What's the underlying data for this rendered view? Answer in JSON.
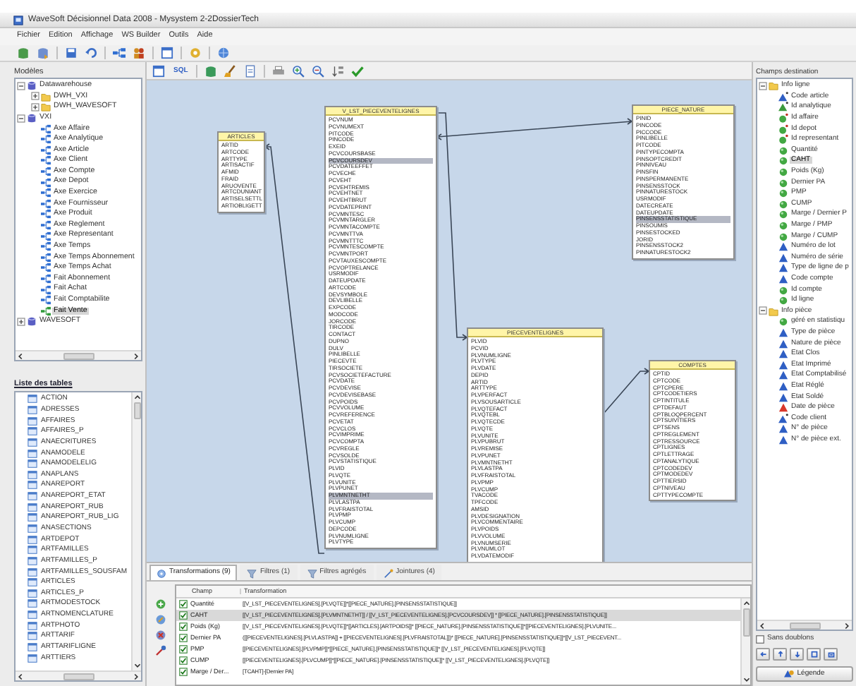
{
  "window": {
    "title": "WaveSoft Décisionnel Data 2008 - Mysystem 2-2DossierTech"
  },
  "menu": [
    "Fichier",
    "Edition",
    "Affichage",
    "WS Builder",
    "Outils",
    "Aide"
  ],
  "diagram_toolbar": {
    "sql_label": "SQL"
  },
  "models": {
    "label": "Modèles",
    "tree": [
      {
        "label": "Datawarehouse",
        "kind": "database",
        "expanded": true,
        "selected": false,
        "children": [
          {
            "label": "DWH_VXI",
            "kind": "folder",
            "expanded": false,
            "selected": false
          },
          {
            "label": "DWH_WAVESOFT",
            "kind": "folder",
            "expanded": false,
            "selected": false
          }
        ]
      },
      {
        "label": "VXI",
        "kind": "database",
        "expanded": true,
        "selected": false,
        "children": [
          {
            "label": "Axe Affaire",
            "kind": "axis",
            "selected": false
          },
          {
            "label": "Axe Analytique",
            "kind": "axis",
            "selected": false
          },
          {
            "label": "Axe Article",
            "kind": "axis",
            "selected": false
          },
          {
            "label": "Axe Client",
            "kind": "axis",
            "selected": false
          },
          {
            "label": "Axe Compte",
            "kind": "axis",
            "selected": false
          },
          {
            "label": "Axe Depot",
            "kind": "axis",
            "selected": false
          },
          {
            "label": "Axe Exercice",
            "kind": "axis",
            "selected": false
          },
          {
            "label": "Axe Fournisseur",
            "kind": "axis",
            "selected": false
          },
          {
            "label": "Axe Produit",
            "kind": "axis",
            "selected": false
          },
          {
            "label": "Axe Reglement",
            "kind": "axis",
            "selected": false
          },
          {
            "label": "Axe Representant",
            "kind": "axis",
            "selected": false
          },
          {
            "label": "Axe Temps",
            "kind": "axis",
            "selected": false
          },
          {
            "label": "Axe Temps Abonnement",
            "kind": "axis",
            "selected": false
          },
          {
            "label": "Axe Temps Achat",
            "kind": "axis",
            "selected": false
          },
          {
            "label": "Fait Abonnement",
            "kind": "axis",
            "selected": false
          },
          {
            "label": "Fait Achat",
            "kind": "axis",
            "selected": false
          },
          {
            "label": "Fait Comptabilite",
            "kind": "axis",
            "selected": false
          },
          {
            "label": "Fait Vente",
            "kind": "axis",
            "selected": true
          }
        ]
      },
      {
        "label": "WAVESOFT",
        "kind": "database",
        "expanded": false,
        "selected": false
      }
    ]
  },
  "tables_list": {
    "label": "Liste des tables",
    "items": [
      "ACTION",
      "ADRESSES",
      "AFFAIRES",
      "AFFAIRES_P",
      "ANAECRITURES",
      "ANAMODELE",
      "ANAMODELELIG",
      "ANAPLANS",
      "ANAREPORT",
      "ANAREPORT_ETAT",
      "ANAREPORT_RUB",
      "ANAREPORT_RUB_LIG",
      "ANASECTIONS",
      "ARTDEPOT",
      "ARTFAMILLES",
      "ARTFAMILLES_P",
      "ARTFAMILLES_SOUSFAM",
      "ARTICLES",
      "ARTICLES_P",
      "ARTMODESTOCK",
      "ARTNOMENCLATURE",
      "ARTPHOTO",
      "ARTTARIF",
      "ARTTARIFLIGNE",
      "ARTTIERS"
    ]
  },
  "diagram": {
    "tables": [
      {
        "name": "ARTICLES",
        "fields": [
          {
            "name": "ARTID",
            "selected": false
          },
          {
            "name": "ARTCODE",
            "selected": false
          },
          {
            "name": "ARTTYPE",
            "selected": false
          },
          {
            "name": "ARTISACTIF",
            "selected": false
          },
          {
            "name": "AFMID",
            "selected": false
          },
          {
            "name": "FRAID",
            "selected": false
          },
          {
            "name": "ARUOVENTE",
            "selected": false
          },
          {
            "name": "ARTCDUNIANT",
            "selected": false
          },
          {
            "name": "ARTISELSETTL",
            "selected": false
          },
          {
            "name": "ARTIOBLIGETT",
            "selected": false
          }
        ]
      },
      {
        "name": "V_LST_PIECEVENTELIGNES",
        "fields": [
          {
            "name": "PCVNUM",
            "selected": false
          },
          {
            "name": "PCVNUMEXT",
            "selected": false
          },
          {
            "name": "PITCODE",
            "selected": false
          },
          {
            "name": "PINCODE",
            "selected": false
          },
          {
            "name": "EXEID",
            "selected": false
          },
          {
            "name": "PCVCOURSBASE",
            "selected": false
          },
          {
            "name": "PCVCOURSDEV",
            "selected": true
          },
          {
            "name": "PCVDATEEFFET",
            "selected": false
          },
          {
            "name": "PCVECHE",
            "selected": false
          },
          {
            "name": "PCVEHT",
            "selected": false
          },
          {
            "name": "PCVEHTREMIS",
            "selected": false
          },
          {
            "name": "PCVEHTNET",
            "selected": false
          },
          {
            "name": "PCVEHTBRUT",
            "selected": false
          },
          {
            "name": "PCVDATEPRINT",
            "selected": false
          },
          {
            "name": "PCVMNTESC",
            "selected": false
          },
          {
            "name": "PCVMNTARGLER",
            "selected": false
          },
          {
            "name": "PCVMNTACOMPTE",
            "selected": false
          },
          {
            "name": "PCVMNTTVA",
            "selected": false
          },
          {
            "name": "PCVMNTTTC",
            "selected": false
          },
          {
            "name": "PCVMNTESCOMPTE",
            "selected": false
          },
          {
            "name": "PCVMNTPORT",
            "selected": false
          },
          {
            "name": "PCVTAUXESCOMPTE",
            "selected": false
          },
          {
            "name": "PCVOPTRELANCE",
            "selected": false
          },
          {
            "name": "USRMODIF",
            "selected": false
          },
          {
            "name": "DATEUPDATE",
            "selected": false
          },
          {
            "name": "ARTCODE",
            "selected": false
          },
          {
            "name": "DEVSYMBOLE",
            "selected": false
          },
          {
            "name": "DEVLIBELLE",
            "selected": false
          },
          {
            "name": "EXPCODE",
            "selected": false
          },
          {
            "name": "MODCODE",
            "selected": false
          },
          {
            "name": "JORCODE",
            "selected": false
          },
          {
            "name": "TIRCODE",
            "selected": false
          },
          {
            "name": "CONTACT",
            "selected": false
          },
          {
            "name": "DUPNO",
            "selected": false
          },
          {
            "name": "DULV",
            "selected": false
          },
          {
            "name": "PINLIBELLE",
            "selected": false
          },
          {
            "name": "PIECEVTE",
            "selected": false
          },
          {
            "name": "TIRSOCIETE",
            "selected": false
          },
          {
            "name": "PCVSOCIETEFACTURE",
            "selected": false
          },
          {
            "name": "PCVDATE",
            "selected": false
          },
          {
            "name": "PCVDEVISE",
            "selected": false
          },
          {
            "name": "PCVDEVISEBASE",
            "selected": false
          },
          {
            "name": "PCVPOIDS",
            "selected": false
          },
          {
            "name": "PCVVOLUME",
            "selected": false
          },
          {
            "name": "PCVREFERENCE",
            "selected": false
          },
          {
            "name": "PCVETAT",
            "selected": false
          },
          {
            "name": "PCVCLOS",
            "selected": false
          },
          {
            "name": "PCVIMPRIME",
            "selected": false
          },
          {
            "name": "PCVCOMPTA",
            "selected": false
          },
          {
            "name": "PCVREGLE",
            "selected": false
          },
          {
            "name": "PCVSOLDE",
            "selected": false
          },
          {
            "name": "PCVSTATISTIQUE",
            "selected": false
          },
          {
            "name": "PLVID",
            "selected": false
          },
          {
            "name": "PLVQTE",
            "selected": false
          },
          {
            "name": "PLVUNITE",
            "selected": false
          },
          {
            "name": "PLVPUNET",
            "selected": false
          },
          {
            "name": "PLVMNTNETHT",
            "selected": true
          },
          {
            "name": "PLVLASTPA",
            "selected": false
          },
          {
            "name": "PLVFRAISTOTAL",
            "selected": false
          },
          {
            "name": "PLVPMP",
            "selected": false
          },
          {
            "name": "PLVCUMP",
            "selected": false
          },
          {
            "name": "DEPCODE",
            "selected": false
          },
          {
            "name": "PLVNUMLIGNE",
            "selected": false
          },
          {
            "name": "PLVTYPE",
            "selected": false
          }
        ]
      },
      {
        "name": "PIECE_NATURE",
        "fields": [
          {
            "name": "PINID",
            "selected": false
          },
          {
            "name": "PINCODE",
            "selected": false
          },
          {
            "name": "PICCODE",
            "selected": false
          },
          {
            "name": "PINLIBELLE",
            "selected": false
          },
          {
            "name": "PITCODE",
            "selected": false
          },
          {
            "name": "PINTYPECOMPTA",
            "selected": false
          },
          {
            "name": "PINSOPTCREDIT",
            "selected": false
          },
          {
            "name": "PINNIVEAU",
            "selected": false
          },
          {
            "name": "PINSFIN",
            "selected": false
          },
          {
            "name": "PINSPERMANENTE",
            "selected": false
          },
          {
            "name": "PINSENSSTOCK",
            "selected": false
          },
          {
            "name": "PINNATURESTOCK",
            "selected": false
          },
          {
            "name": "USRMODIF",
            "selected": false
          },
          {
            "name": "DATECREATE",
            "selected": false
          },
          {
            "name": "DATEUPDATE",
            "selected": false
          },
          {
            "name": "PINSENSSTATISTIQUE",
            "selected": true
          },
          {
            "name": "PINSOUMIS",
            "selected": false
          },
          {
            "name": "PINSESTOCKED",
            "selected": false
          },
          {
            "name": "JORID",
            "selected": false
          },
          {
            "name": "PINSENSSTOCK2",
            "selected": false
          },
          {
            "name": "PINNATURESTOCK2",
            "selected": false
          }
        ]
      },
      {
        "name": "PIECEVENTELIGNES",
        "fields": [
          {
            "name": "PLVID",
            "selected": false
          },
          {
            "name": "PCVID",
            "selected": false
          },
          {
            "name": "PLVNUMLIGNE",
            "selected": false
          },
          {
            "name": "PLVTYPE",
            "selected": false
          },
          {
            "name": "PLVDATE",
            "selected": false
          },
          {
            "name": "DEPID",
            "selected": false
          },
          {
            "name": "ARTID",
            "selected": false
          },
          {
            "name": "ARTTYPE",
            "selected": false
          },
          {
            "name": "PLVPERFACT",
            "selected": false
          },
          {
            "name": "PLVSOUSARTICLE",
            "selected": false
          },
          {
            "name": "PLVQTEFACT",
            "selected": false
          },
          {
            "name": "PLVQTEBL",
            "selected": false
          },
          {
            "name": "PLVQTECDE",
            "selected": false
          },
          {
            "name": "PLVQTE",
            "selected": false
          },
          {
            "name": "PLVUNITE",
            "selected": false
          },
          {
            "name": "PLVPUBRUT",
            "selected": false
          },
          {
            "name": "PLVREMISE",
            "selected": false
          },
          {
            "name": "PLVPUNET",
            "selected": false
          },
          {
            "name": "PLVMNTNETHT",
            "selected": false
          },
          {
            "name": "PLVLASTPA",
            "selected": false
          },
          {
            "name": "PLVFRAISTOTAL",
            "selected": false
          },
          {
            "name": "PLVPMP",
            "selected": false
          },
          {
            "name": "PLVCUMP",
            "selected": false
          },
          {
            "name": "TVACODE",
            "selected": false
          },
          {
            "name": "TPFCODE",
            "selected": false
          },
          {
            "name": "AMSID",
            "selected": false
          },
          {
            "name": "PLVDESIGNATION",
            "selected": false
          },
          {
            "name": "PLVCOMMENTAIRE",
            "selected": false
          },
          {
            "name": "PLVPOIDS",
            "selected": false
          },
          {
            "name": "PLVVOLUME",
            "selected": false
          },
          {
            "name": "PLVNUMSERIE",
            "selected": false
          },
          {
            "name": "PLVNUMLOT",
            "selected": false
          },
          {
            "name": "PLVDATEMODIF",
            "selected": false
          }
        ]
      },
      {
        "name": "COMPTES",
        "fields": [
          {
            "name": "CPTID",
            "selected": false
          },
          {
            "name": "CPTCODE",
            "selected": false
          },
          {
            "name": "CPTCPERE",
            "selected": false
          },
          {
            "name": "CPTCODETIERS",
            "selected": false
          },
          {
            "name": "CPTINTITULE",
            "selected": false
          },
          {
            "name": "CPTDEFAUT",
            "selected": false
          },
          {
            "name": "CPTBLOQPERCENT",
            "selected": false
          },
          {
            "name": "CPTSUIVITIERS",
            "selected": false
          },
          {
            "name": "CPTSENS",
            "selected": false
          },
          {
            "name": "CPTREGLEMENT",
            "selected": false
          },
          {
            "name": "CPTRESSOURCE",
            "selected": false
          },
          {
            "name": "CPTLIGNES",
            "selected": false
          },
          {
            "name": "CPTLETTRAGE",
            "selected": false
          },
          {
            "name": "CPTANALYTIQUE",
            "selected": false
          },
          {
            "name": "CPTCODEDEV",
            "selected": false
          },
          {
            "name": "CPTMODEDEV",
            "selected": false
          },
          {
            "name": "CPTTIERSID",
            "selected": false
          },
          {
            "name": "CPTNIVEAU",
            "selected": false
          },
          {
            "name": "CPTTYPECOMPTE",
            "selected": false
          }
        ]
      }
    ]
  },
  "bottom_tabs": [
    {
      "label": "Transformations (9)",
      "kind": "transform",
      "selected": true
    },
    {
      "label": "Filtres (1)",
      "kind": "filter",
      "selected": false
    },
    {
      "label": "Filtres agrégés",
      "kind": "filter",
      "selected": false
    },
    {
      "label": "Jointures (4)",
      "kind": "join",
      "selected": false
    }
  ],
  "grid": {
    "columns": [
      "Champ",
      "Transformation"
    ],
    "rows": [
      {
        "checked": true,
        "selected": false,
        "champ": "Quantité",
        "transformation": "[[V_LST_PIECEVENTELIGNES].[PLVQTE]]*[[PIECE_NATURE].[PINSENSSTATISTIQUE]]"
      },
      {
        "checked": true,
        "selected": true,
        "champ": "CAHT",
        "transformation": "[[V_LST_PIECEVENTELIGNES].[PLVMNTNETHT]] / [[V_LST_PIECEVENTELIGNES].[PCVCOURSDEV]] * [[PIECE_NATURE].[PINSENSSTATISTIQUE]]"
      },
      {
        "checked": true,
        "selected": false,
        "champ": "Poids (Kg)",
        "transformation": "[[V_LST_PIECEVENTELIGNES].[PLVQTE]]*[[ARTICLES].[ARTPOIDS]]* [[PIECE_NATURE].[PINSENSSTATISTIQUE]]*[[PIECEVENTELIGNES].[PLVUNITE..."
      },
      {
        "checked": true,
        "selected": false,
        "champ": "Dernier PA",
        "transformation": "([[PIECEVENTELIGNES].[PLVLASTPA]] + [[PIECEVENTELIGNES].[PLVFRAISTOTAL]])* [[PIECE_NATURE].[PINSENSSTATISTIQUE]]*[[V_LST_PIECEVENT..."
      },
      {
        "checked": true,
        "selected": false,
        "champ": "PMP",
        "transformation": "[[PIECEVENTELIGNES].[PLVPMP]]*[[PIECE_NATURE].[PINSENSSTATISTIQUE]]* [[V_LST_PIECEVENTELIGNES].[PLVQTE]]"
      },
      {
        "checked": true,
        "selected": false,
        "champ": "CUMP",
        "transformation": "[[PIECEVENTELIGNES].[PLVCUMP]]*[[PIECE_NATURE].[PINSENSSTATISTIQUE]]* [[V_LST_PIECEVENTELIGNES].[PLVQTE]]"
      },
      {
        "checked": true,
        "selected": false,
        "champ": "Marge / Der...",
        "transformation": "[TCAHT]-[Dernier PA]"
      }
    ]
  },
  "destination": {
    "label": "Champs destination",
    "tree": [
      {
        "label": "Info ligne",
        "kind": "folder",
        "expanded": true,
        "selected": false,
        "children": [
          {
            "label": "Code article",
            "kind": "dimension-key",
            "selected": false
          },
          {
            "label": "Id analytique",
            "kind": "analytic",
            "selected": false
          },
          {
            "label": "Id affaire",
            "kind": "measure-key",
            "selected": false
          },
          {
            "label": "Id depot",
            "kind": "measure-key",
            "selected": false
          },
          {
            "label": "Id representant",
            "kind": "measure-key",
            "selected": false
          },
          {
            "label": "Quantité",
            "kind": "measure",
            "selected": false
          },
          {
            "label": "CAHT",
            "kind": "measure",
            "selected": true
          },
          {
            "label": "Poids (Kg)",
            "kind": "measure",
            "selected": false
          },
          {
            "label": "Dernier PA",
            "kind": "measure",
            "selected": false
          },
          {
            "label": "PMP",
            "kind": "measure",
            "selected": false
          },
          {
            "label": "CUMP",
            "kind": "measure",
            "selected": false
          },
          {
            "label": "Marge / Dernier P",
            "kind": "measure",
            "selected": false
          },
          {
            "label": "Marge / PMP",
            "kind": "measure",
            "selected": false
          },
          {
            "label": "Marge / CUMP",
            "kind": "measure",
            "selected": false
          },
          {
            "label": "Numéro de lot",
            "kind": "dimension",
            "selected": false
          },
          {
            "label": "Numéro de série",
            "kind": "dimension",
            "selected": false
          },
          {
            "label": "Type de ligne de p",
            "kind": "dimension",
            "selected": false
          },
          {
            "label": "Code compte",
            "kind": "dimension",
            "selected": false
          },
          {
            "label": "Id compte",
            "kind": "measure",
            "selected": false
          },
          {
            "label": "Id ligne",
            "kind": "measure",
            "selected": false
          }
        ]
      },
      {
        "label": "Info pièce",
        "kind": "folder",
        "expanded": true,
        "selected": false,
        "children": [
          {
            "label": "géré en statistiqu",
            "kind": "measure",
            "selected": false
          },
          {
            "label": "Type de pièce",
            "kind": "dimension",
            "selected": false
          },
          {
            "label": "Nature de pièce",
            "kind": "dimension",
            "selected": false
          },
          {
            "label": "Etat Clos",
            "kind": "dimension",
            "selected": false
          },
          {
            "label": "Etat Imprimé",
            "kind": "dimension",
            "selected": false
          },
          {
            "label": "Etat Comptabilisé",
            "kind": "dimension",
            "selected": false
          },
          {
            "label": "Etat Réglé",
            "kind": "dimension",
            "selected": false
          },
          {
            "label": "Etat Soldé",
            "kind": "dimension",
            "selected": false
          },
          {
            "label": "Date de pièce",
            "kind": "date",
            "selected": false
          },
          {
            "label": "Code client",
            "kind": "dimension-key",
            "selected": false
          },
          {
            "label": "N° de pièce",
            "kind": "dimension",
            "selected": false
          },
          {
            "label": "N° de pièce ext.",
            "kind": "dimension",
            "selected": false
          }
        ]
      }
    ]
  },
  "sans_doublons": {
    "label": "Sans doublons",
    "checked": false
  },
  "legend_button": "Légende"
}
